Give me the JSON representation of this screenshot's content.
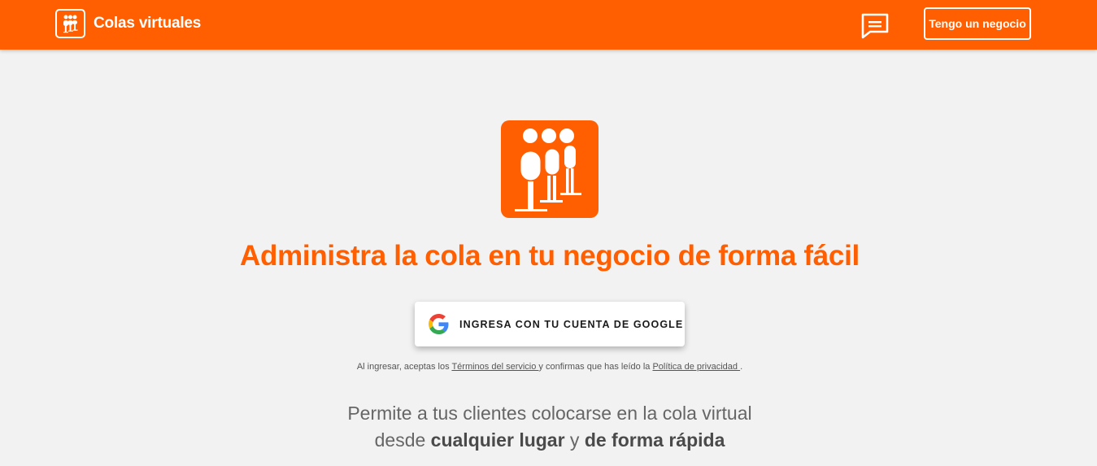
{
  "header": {
    "brand_name": "Colas virtuales",
    "business_button": "Tengo un negocio"
  },
  "hero": {
    "headline": "Administra la cola en tu negocio de forma fácil",
    "google_button": "INGRESA CON TU CUENTA DE GOOGLE"
  },
  "legal": {
    "prefix": "Al ingresar, aceptas los ",
    "terms_link": "Términos del servicio ",
    "middle": "y confirmas que has leído la ",
    "privacy_link": "Política de privacidad ",
    "suffix": "."
  },
  "tagline": {
    "line1": "Permite a tus clientes colocarse en la cola virtual",
    "line2_prefix": "desde ",
    "line2_bold1": "cualquier lugar",
    "line2_middle": " y ",
    "line2_bold2": "de forma rápida"
  },
  "colors": {
    "brand_orange": "#ff5f00",
    "background": "#f2f2f2"
  },
  "icons": {
    "brand": "queue-people-icon",
    "chat": "chat-bubble-icon",
    "google": "google-g-icon"
  }
}
